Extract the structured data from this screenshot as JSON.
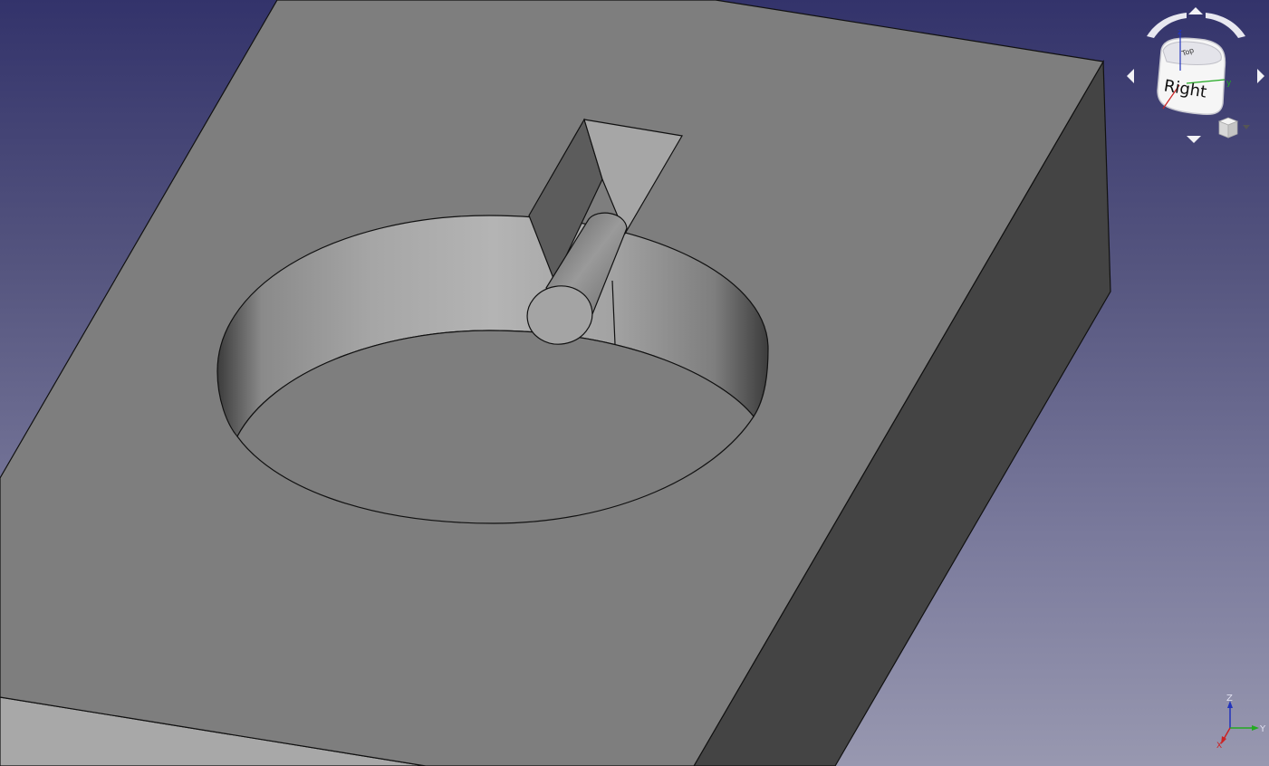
{
  "navigation_cube": {
    "face_label": "Right",
    "top_face_hint": "Top",
    "axis_letters": {
      "x": "x",
      "y": "y",
      "z": "z"
    }
  },
  "axis_indicator": {
    "x_label": "X",
    "y_label": "Y",
    "z_label": "Z"
  },
  "colors": {
    "background_top": "#33336b",
    "background_bottom": "#9898b0",
    "top_face": "#7e7e7e",
    "side_face": "#444444",
    "edge": "#111111",
    "x_axis": "#cc2222",
    "y_axis": "#22aa22",
    "z_axis": "#2233bb"
  },
  "icons": {
    "rotate_left": "curved-arrow-left-icon",
    "rotate_right": "curved-arrow-right-icon",
    "nav_up": "triangle-up-icon",
    "nav_down": "triangle-down-icon",
    "nav_left": "triangle-left-icon",
    "nav_right": "triangle-right-icon",
    "view_menu": "cube-menu-icon"
  }
}
